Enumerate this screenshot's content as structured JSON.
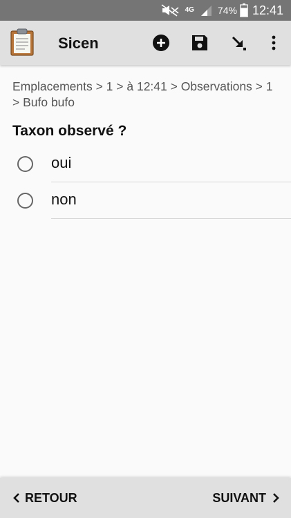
{
  "status_bar": {
    "network": "4G",
    "battery_percent": "74%",
    "time": "12:41",
    "icons": [
      "mute-icon",
      "signal-icon",
      "battery-icon"
    ]
  },
  "toolbar": {
    "title": "Sicen",
    "icons": [
      "clipboard-icon",
      "add-circle-icon",
      "save-icon",
      "download-arrow-icon",
      "more-vert-icon"
    ]
  },
  "breadcrumb": "Emplacements > 1 > à 12:41 > Observations > 1 > Bufo bufo",
  "question": "Taxon observé ?",
  "options": [
    {
      "label": "oui",
      "selected": false
    },
    {
      "label": "non",
      "selected": false
    }
  ],
  "navigation": {
    "prev_label": "RETOUR",
    "next_label": "SUIVANT"
  }
}
